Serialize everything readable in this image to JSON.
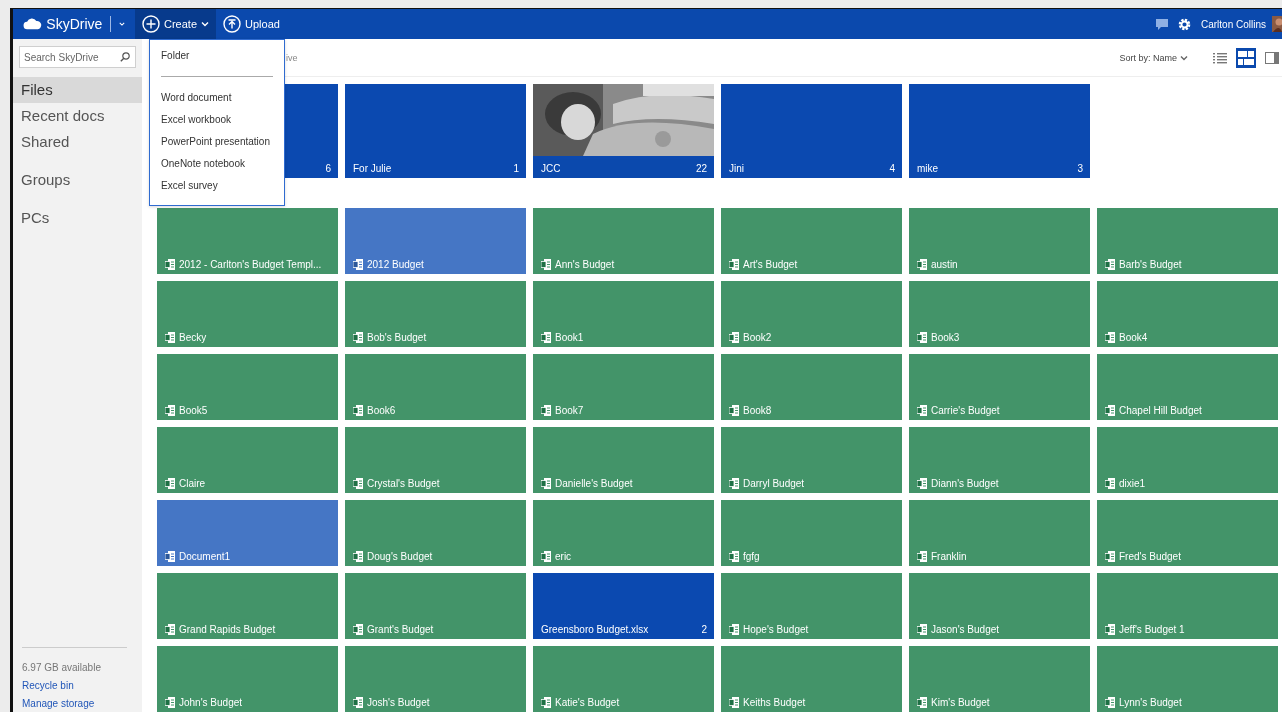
{
  "top_bar": {
    "logo": "SkyDrive",
    "actions": [
      {
        "label": "Create",
        "kind": "create",
        "open": true
      },
      {
        "label": "Upload",
        "kind": "upload",
        "open": false
      }
    ],
    "user": "Carlton Collins"
  },
  "create_menu": [
    {
      "label": "Folder",
      "separator_after": true
    },
    {
      "label": "Word document",
      "separator_after": false
    },
    {
      "label": "Excel workbook",
      "separator_after": false
    },
    {
      "label": "PowerPoint presentation",
      "separator_after": false
    },
    {
      "label": "OneNote notebook",
      "separator_after": false
    },
    {
      "label": "Excel survey",
      "separator_after": false
    }
  ],
  "sidebar": {
    "search": {
      "placeholder": "Search SkyDrive"
    },
    "nav_groups": [
      [
        {
          "label": "Files",
          "selected": true
        },
        {
          "label": "Recent docs",
          "selected": false
        },
        {
          "label": "Shared",
          "selected": false
        }
      ],
      [
        {
          "label": "Groups",
          "selected": false
        }
      ],
      [
        {
          "label": "PCs",
          "selected": false
        }
      ]
    ],
    "storage": "6.97 GB available",
    "links": [
      "Recycle bin",
      "Manage storage"
    ]
  },
  "breadcrumb": "ive",
  "toolbar": {
    "sort": "Sort by: Name",
    "views": [
      {
        "kind": "list",
        "selected": false
      },
      {
        "kind": "tiles",
        "selected": true
      },
      {
        "kind": "details",
        "selected": false
      }
    ]
  },
  "folders": [
    {
      "kind": "folder",
      "count": "6"
    },
    {
      "kind": "folder",
      "name": "For Julie",
      "count": "1"
    },
    {
      "name": "JCC",
      "count": "22"
    },
    {
      "kind": "folder",
      "name": "Jini",
      "count": "4"
    },
    {
      "kind": "folder",
      "name": "mike",
      "count": "3"
    }
  ],
  "files": [
    {
      "kind": "excel",
      "name": "2012 - Carlton's Budget Templ..."
    },
    {
      "kind": "word",
      "name": "2012 Budget"
    },
    {
      "kind": "excel",
      "name": "Ann's Budget"
    },
    {
      "kind": "excel",
      "name": "Art's Budget"
    },
    {
      "kind": "excel",
      "name": "austin"
    },
    {
      "kind": "excel",
      "name": "Barb's Budget"
    },
    {
      "kind": "excel",
      "name": "Becky"
    },
    {
      "kind": "excel",
      "name": "Bob's Budget"
    },
    {
      "kind": "excel",
      "name": "Book1"
    },
    {
      "kind": "excel",
      "name": "Book2"
    },
    {
      "kind": "excel",
      "name": "Book3"
    },
    {
      "kind": "excel",
      "name": "Book4"
    },
    {
      "kind": "excel",
      "name": "Book5"
    },
    {
      "kind": "excel",
      "name": "Book6"
    },
    {
      "kind": "excel",
      "name": "Book7"
    },
    {
      "kind": "excel",
      "name": "Book8"
    },
    {
      "kind": "excel",
      "name": "Carrie's Budget"
    },
    {
      "kind": "excel",
      "name": "Chapel Hill Budget"
    },
    {
      "kind": "excel",
      "name": "Claire"
    },
    {
      "kind": "excel",
      "name": "Crystal's Budget"
    },
    {
      "kind": "excel",
      "name": "Danielle's Budget"
    },
    {
      "kind": "excel",
      "name": "Darryl Budget"
    },
    {
      "kind": "excel",
      "name": "Diann's Budget"
    },
    {
      "kind": "excel",
      "name": "dixie1"
    },
    {
      "kind": "word",
      "name": "Document1"
    },
    {
      "kind": "excel",
      "name": "Doug's Budget"
    },
    {
      "kind": "excel",
      "name": "eric"
    },
    {
      "kind": "excel",
      "name": "fgfg"
    },
    {
      "kind": "excel",
      "name": "Franklin"
    },
    {
      "kind": "excel",
      "name": "Fred's Budget"
    },
    {
      "kind": "excel",
      "name": "Grand Rapids Budget"
    },
    {
      "kind": "excel",
      "name": "Grant's Budget"
    },
    {
      "kind": "folder",
      "name": "Greensboro Budget.xlsx",
      "count": "2"
    },
    {
      "kind": "excel",
      "name": "Hope's Budget"
    },
    {
      "kind": "excel",
      "name": "Jason's Budget"
    },
    {
      "kind": "excel",
      "name": "Jeff's Budget 1"
    },
    {
      "kind": "excel",
      "name": "John's Budget"
    },
    {
      "kind": "excel",
      "name": "Josh's Budget"
    },
    {
      "kind": "excel",
      "name": "Katie's Budget"
    },
    {
      "kind": "excel",
      "name": "Keiths Budget"
    },
    {
      "kind": "excel",
      "name": "Kim's Budget"
    },
    {
      "kind": "excel",
      "name": "Lynn's Budget"
    }
  ]
}
